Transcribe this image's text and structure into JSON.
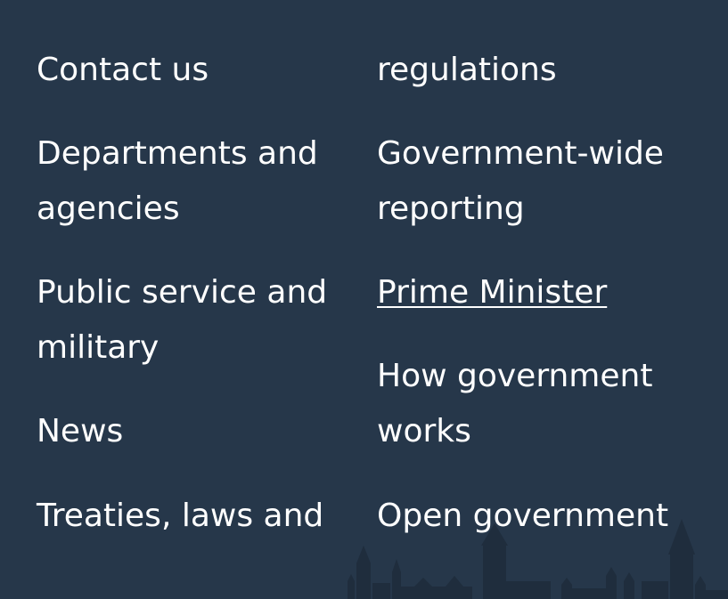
{
  "footer": {
    "left_links": [
      {
        "label": "Contact us"
      },
      {
        "label": "Departments and"
      },
      {
        "label": "agencies"
      },
      {
        "label": "Public service and"
      },
      {
        "label": "military"
      },
      {
        "label": "News"
      },
      {
        "label": "Treaties, laws and"
      }
    ],
    "right_links": [
      {
        "label": "regulations"
      },
      {
        "label": "Government-wide"
      },
      {
        "label": "reporting"
      },
      {
        "label": "Prime Minister"
      },
      {
        "label": "How government"
      },
      {
        "label": "works"
      },
      {
        "label": "Open government"
      }
    ]
  },
  "colors": {
    "background": "#26374a",
    "text": "#ffffff",
    "skyline": "#1f2d3d"
  }
}
